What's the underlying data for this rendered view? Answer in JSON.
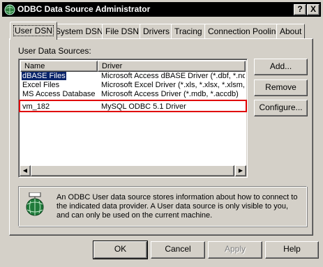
{
  "window": {
    "title": "ODBC Data Source Administrator",
    "help_btn": "?",
    "close_btn": "X"
  },
  "tabs": [
    {
      "label": "User DSN",
      "active": true
    },
    {
      "label": "System DSN"
    },
    {
      "label": "File DSN"
    },
    {
      "label": "Drivers"
    },
    {
      "label": "Tracing"
    },
    {
      "label": "Connection Pooling"
    },
    {
      "label": "About"
    }
  ],
  "user_ds": {
    "label": "User Data Sources:",
    "columns": [
      "Name",
      "Driver"
    ],
    "rows": [
      {
        "name": "dBASE Files",
        "driver": "Microsoft Access dBASE Driver (*.dbf, *.ndx",
        "selected": true
      },
      {
        "name": "Excel Files",
        "driver": "Microsoft Excel Driver (*.xls, *.xlsx, *.xlsm, *.x"
      },
      {
        "name": "MS Access Database",
        "driver": "Microsoft Access Driver (*.mdb, *.accdb)"
      },
      {
        "name": "vm_182",
        "driver": "MySQL ODBC 5.1 Driver",
        "highlighted": true
      }
    ]
  },
  "buttons": {
    "add": "Add...",
    "remove": "Remove",
    "configure": "Configure...",
    "ok": "OK",
    "cancel": "Cancel",
    "apply": "Apply",
    "help": "Help"
  },
  "info": {
    "text": "An ODBC User data source stores information about how to connect to the indicated data provider.   A User data source is only visible to you, and can only be used on the current machine."
  },
  "colors": {
    "selection": "#0a246a",
    "highlight_box": "#e00000",
    "face": "#d4d0c8"
  },
  "icons": {
    "title": "odbc-globe-icon",
    "info": "odbc-datasource-icon"
  }
}
